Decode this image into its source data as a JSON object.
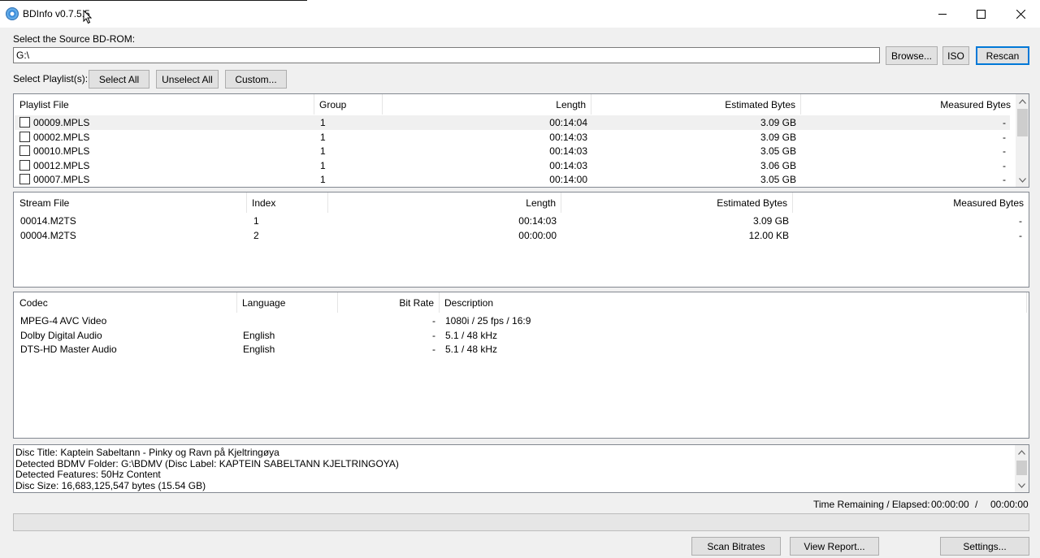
{
  "window": {
    "title": "BDInfo v0.7.5.5",
    "minimize_icon": "minimize-icon",
    "maximize_icon": "maximize-icon",
    "close_icon": "close-icon"
  },
  "source": {
    "label": "Select the Source BD-ROM:",
    "path_value": "G:\\",
    "browse_label": "Browse...",
    "iso_label": "ISO",
    "rescan_label": "Rescan"
  },
  "playlist_controls": {
    "label": "Select Playlist(s):",
    "select_all_label": "Select All",
    "unselect_all_label": "Unselect All",
    "custom_label": "Custom..."
  },
  "playlists": {
    "columns": [
      "Playlist File",
      "Group",
      "Length",
      "Estimated Bytes",
      "Measured Bytes"
    ],
    "rows": [
      {
        "file": "00009.MPLS",
        "group": "1",
        "length": "00:14:04",
        "estimated": "3.09 GB",
        "measured": "-"
      },
      {
        "file": "00002.MPLS",
        "group": "1",
        "length": "00:14:03",
        "estimated": "3.09 GB",
        "measured": "-"
      },
      {
        "file": "00010.MPLS",
        "group": "1",
        "length": "00:14:03",
        "estimated": "3.05 GB",
        "measured": "-"
      },
      {
        "file": "00012.MPLS",
        "group": "1",
        "length": "00:14:03",
        "estimated": "3.06 GB",
        "measured": "-"
      },
      {
        "file": "00007.MPLS",
        "group": "1",
        "length": "00:14:00",
        "estimated": "3.05 GB",
        "measured": "-"
      }
    ]
  },
  "streams": {
    "columns": [
      "Stream File",
      "Index",
      "Length",
      "Estimated Bytes",
      "Measured Bytes"
    ],
    "rows": [
      {
        "file": "00014.M2TS",
        "index": "1",
        "length": "00:14:03",
        "estimated": "3.09 GB",
        "measured": "-"
      },
      {
        "file": "00004.M2TS",
        "index": "2",
        "length": "00:00:00",
        "estimated": "12.00 KB",
        "measured": "-"
      }
    ]
  },
  "codecs": {
    "columns": [
      "Codec",
      "Language",
      "Bit Rate",
      "Description"
    ],
    "rows": [
      {
        "codec": "MPEG-4 AVC Video",
        "language": "",
        "bitrate": "-",
        "description": "1080i / 25 fps / 16:9"
      },
      {
        "codec": "Dolby Digital Audio",
        "language": "English",
        "bitrate": "-",
        "description": "5.1 / 48 kHz"
      },
      {
        "codec": "DTS-HD Master Audio",
        "language": "English",
        "bitrate": "-",
        "description": "5.1 / 48 kHz"
      }
    ]
  },
  "disc_info": [
    "Disc Title: Kaptein Sabeltann - Pinky og Ravn på Kjeltringøya",
    "Detected BDMV Folder: G:\\BDMV (Disc Label: KAPTEIN SABELTANN KJELTRINGOYA)",
    "Detected Features: 50Hz Content",
    "Disc Size: 16,683,125,547 bytes (15.54 GB)"
  ],
  "timer": {
    "label": "Time Remaining / Elapsed:",
    "remaining": "00:00:00",
    "separator": "/",
    "elapsed": "00:00:00"
  },
  "progress": {
    "value": 0
  },
  "bottom_buttons": {
    "scan_label": "Scan Bitrates",
    "report_label": "View Report...",
    "settings_label": "Settings..."
  }
}
